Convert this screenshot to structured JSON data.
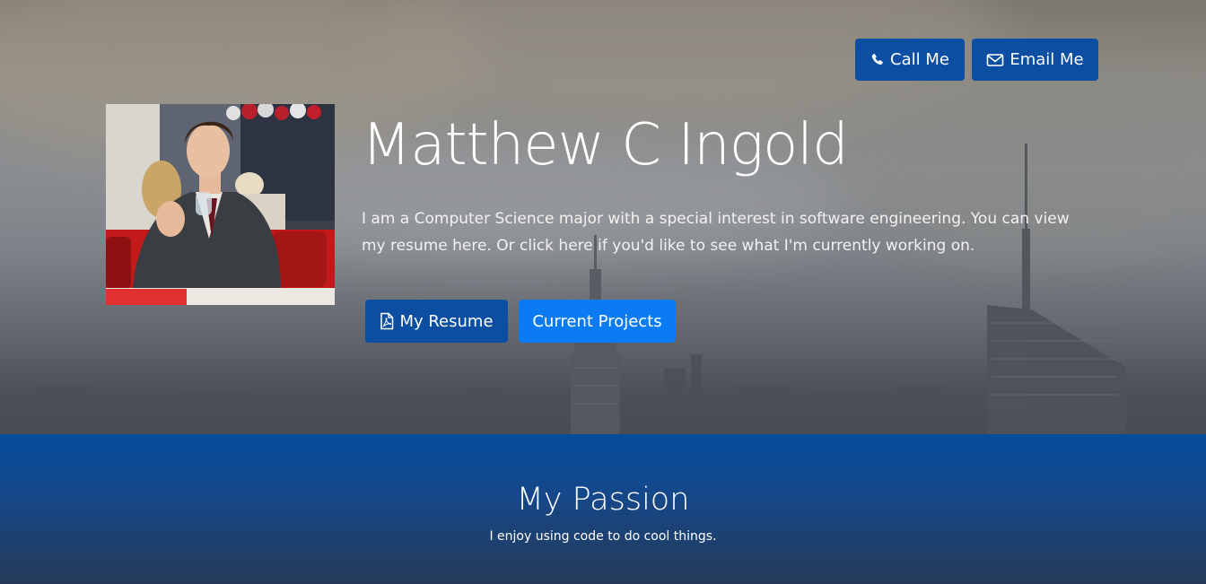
{
  "header": {
    "call_label": "Call Me",
    "email_label": "Email Me",
    "call_icon": "phone-icon",
    "email_icon": "envelope-icon"
  },
  "hero": {
    "name": "Matthew C Ingold",
    "intro": "I am a Computer Science major with a special interest in software engineering. You can view my resume here. Or click here if you'd like to see what I'm currently working on.",
    "resume_label": "My Resume",
    "resume_icon": "pdf-file-icon",
    "projects_label": "Current Projects"
  },
  "passion": {
    "heading": "My Passion",
    "text": "I enjoy using code to do cool things."
  },
  "colors": {
    "button_dark": "#0b4ea2",
    "button_bright": "#0a7bf2",
    "section_blue": "#064c9c"
  }
}
